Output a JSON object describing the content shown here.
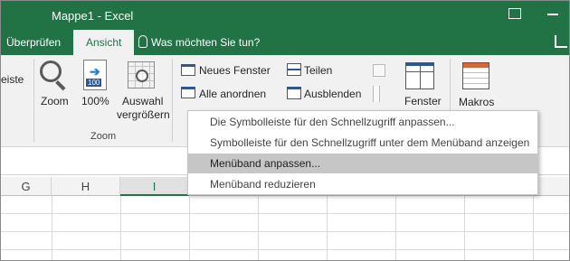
{
  "titlebar": {
    "title": "Mappe1  -  Excel",
    "accent": "#217346",
    "icons": [
      "ribbon-display-options-icon",
      "minimize-icon"
    ]
  },
  "tabs": {
    "items": [
      {
        "label": "Überprüfen",
        "active": false
      },
      {
        "label": "Ansicht",
        "active": true
      }
    ],
    "tell_me": "Was möchten Sie tun?"
  },
  "ribbon": {
    "partial_left": "eiste",
    "zoom_group": {
      "zoom": "Zoom",
      "hundred": "100%",
      "badge": "100",
      "selection_line1": "Auswahl",
      "selection_line2": "vergrößern",
      "group_label": "Zoom"
    },
    "window_group": {
      "new_window": "Neues Fenster",
      "arrange_all": "Alle anordnen",
      "split": "Teilen",
      "hide": "Ausblenden",
      "switch_windows": "Fenster"
    },
    "macros": "Makros"
  },
  "context_menu": {
    "items": [
      {
        "label": "Die Symbolleiste für den Schnellzugriff anpassen...",
        "highlighted": false
      },
      {
        "label": "Symbolleiste für den Schnellzugriff unter dem Menüband anzeigen",
        "highlighted": false
      },
      {
        "label": "Menüband anpassen...",
        "highlighted": true
      },
      {
        "label": "Menüband reduzieren",
        "highlighted": false
      }
    ]
  },
  "sheet": {
    "columns": [
      "G",
      "H",
      "I"
    ],
    "selected_column": "I"
  }
}
